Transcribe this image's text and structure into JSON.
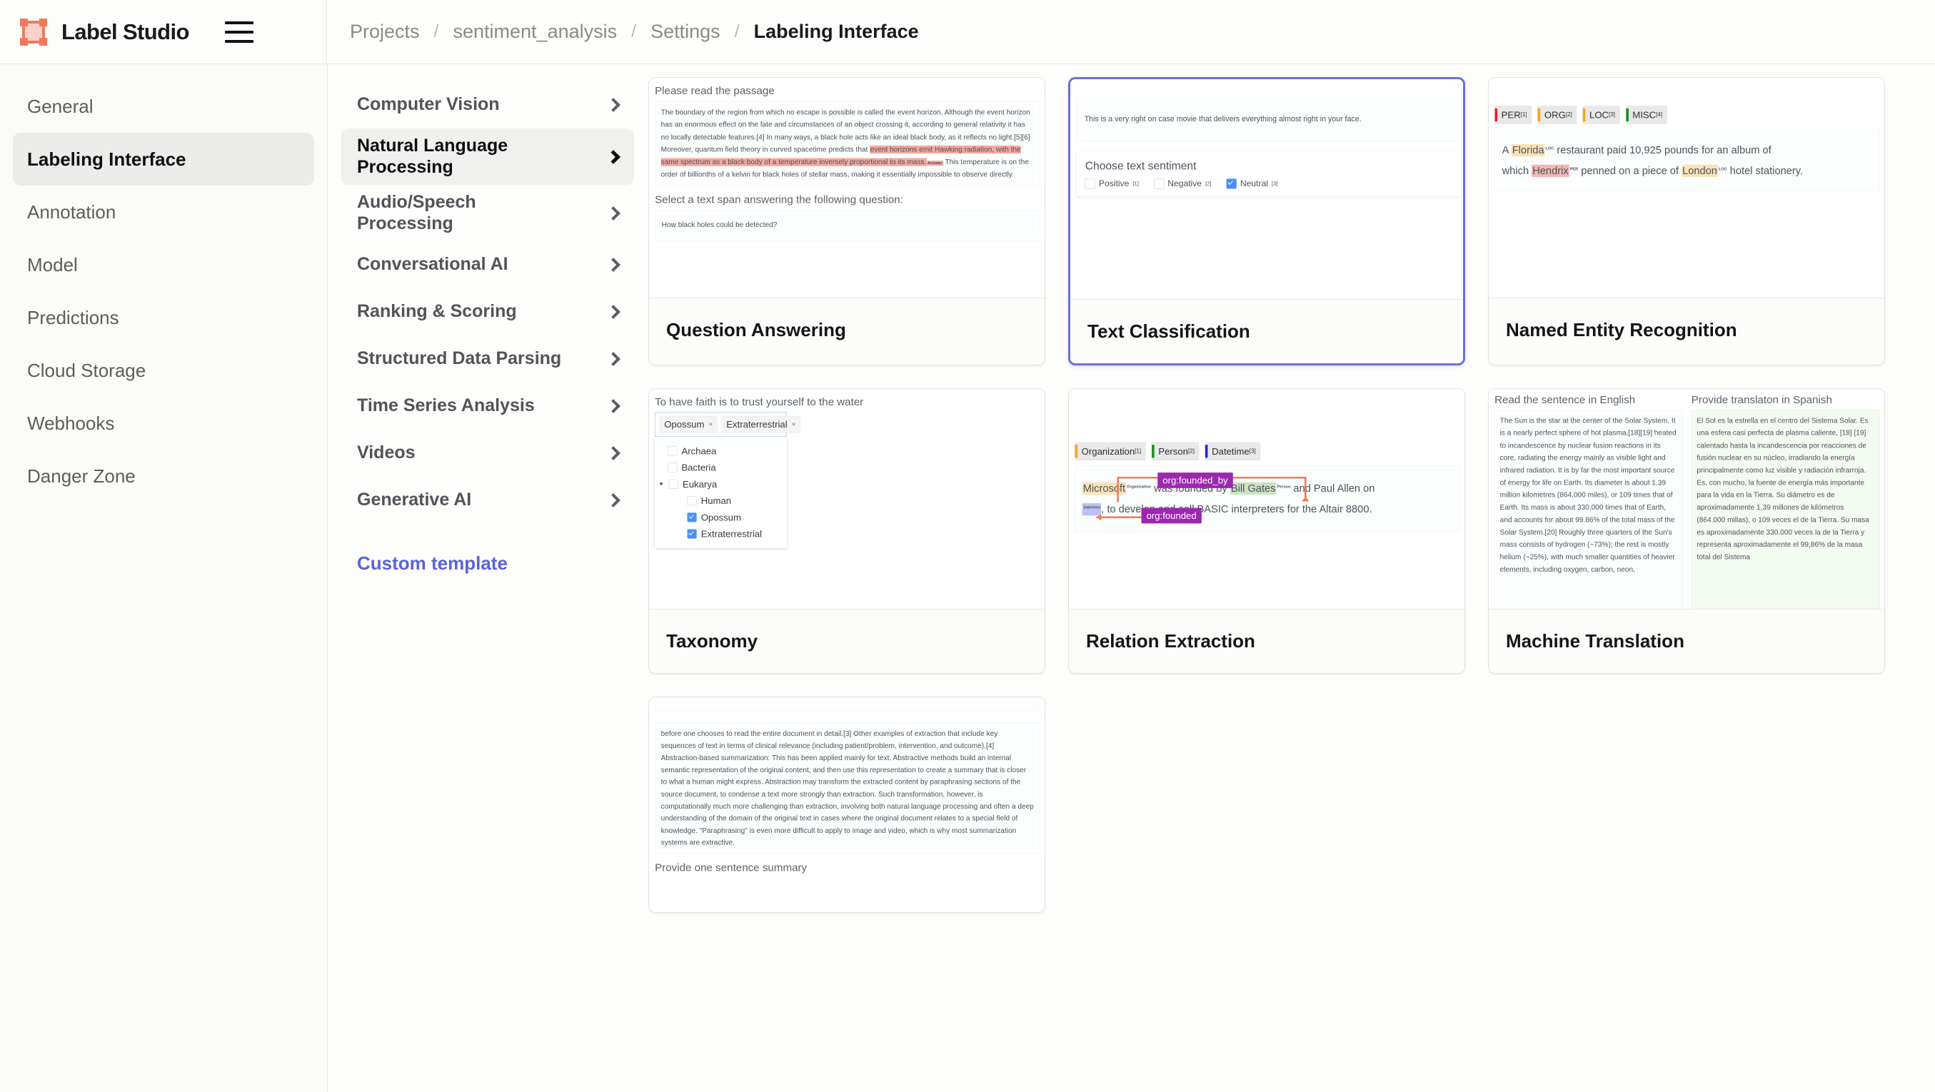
{
  "app": {
    "brand": "Label Studio",
    "logo_icon": "bounding-box-logo-icon",
    "menu_icon": "hamburger-menu-icon"
  },
  "breadcrumb": {
    "items": [
      "Projects",
      "sentiment_analysis",
      "Settings",
      "Labeling Interface"
    ],
    "separator": "/"
  },
  "settings_nav": {
    "items": [
      {
        "label": "General",
        "active": false
      },
      {
        "label": "Labeling Interface",
        "active": true
      },
      {
        "label": "Annotation",
        "active": false
      },
      {
        "label": "Model",
        "active": false
      },
      {
        "label": "Predictions",
        "active": false
      },
      {
        "label": "Cloud Storage",
        "active": false
      },
      {
        "label": "Webhooks",
        "active": false
      },
      {
        "label": "Danger Zone",
        "active": false
      }
    ]
  },
  "categories": {
    "items": [
      {
        "label": "Computer Vision",
        "active": false
      },
      {
        "label": "Natural Language Processing",
        "active": true
      },
      {
        "label": "Audio/Speech Processing",
        "active": false
      },
      {
        "label": "Conversational AI",
        "active": false
      },
      {
        "label": "Ranking & Scoring",
        "active": false
      },
      {
        "label": "Structured Data Parsing",
        "active": false
      },
      {
        "label": "Time Series Analysis",
        "active": false
      },
      {
        "label": "Videos",
        "active": false
      },
      {
        "label": "Generative AI",
        "active": false
      }
    ],
    "custom_template_link": "Custom template"
  },
  "templates": {
    "question_answering": {
      "title": "Question Answering",
      "passage_label": "Please read the passage",
      "passage_pre": "The boundary of the region from which no escape is possible is called the event horizon. Although the event horizon has an enormous effect on the fate and circumstances of an object crossing it, according to general relativity it has no locally detectable features.[4] In many ways, a black hole acts like an ideal black body, as it reflects no light.[5][6] Moreover, quantum field theory in curved spacetime predicts that ",
      "passage_highlight": "event horizons emit Hawking radiation, with the same spectrum as a black body of a temperature inversely proportional to its mass.",
      "passage_highlight_tag": "Answer",
      "passage_post": " This temperature is on the order of billionths of a kelvin for black holes of stellar mass, making it essentially impossible to observe directly.",
      "question_label": "Select a text span answering the following question:",
      "question_text": "How black holes could be detected?"
    },
    "text_classification": {
      "title": "Text Classification",
      "selected": true,
      "text": "This is a very right on case movie that delivers everything almost right in your face.",
      "choices_title": "Choose text sentiment",
      "choices": [
        {
          "label": "Positive",
          "hotkey": "[1]",
          "checked": false
        },
        {
          "label": "Negative",
          "hotkey": "[2]",
          "checked": false
        },
        {
          "label": "Neutral",
          "hotkey": "[3]",
          "checked": true
        }
      ]
    },
    "named_entity_recognition": {
      "title": "Named Entity Recognition",
      "labels": [
        {
          "name": "PER",
          "hotkey": "[1]",
          "color": "#ed1c24"
        },
        {
          "name": "ORG",
          "hotkey": "[2]",
          "color": "#f5a623"
        },
        {
          "name": "LOC",
          "hotkey": "[3]",
          "color": "#f5a623"
        },
        {
          "name": "MISC",
          "hotkey": "[4]",
          "color": "#1d8a1d"
        }
      ],
      "text_a": "A ",
      "ent_florida": "Florida",
      "ent_florida_tag": "LOC",
      "text_b": " restaurant paid 10,925 pounds for an album of ",
      "text_c": "which ",
      "ent_hendrix": "Hendrix",
      "ent_hendrix_tag": "PER",
      "text_d": " penned on a piece of ",
      "ent_london": "London",
      "ent_london_tag": "LOC",
      "text_e": " hotel stationery."
    },
    "taxonomy": {
      "title": "Taxonomy",
      "prompt": "To have faith is to trust yourself to the water",
      "selected_tags": [
        "Opossum",
        "Extraterrestrial"
      ],
      "remove_icon": "×",
      "options": [
        {
          "label": "Archaea",
          "checked": false,
          "indent": false,
          "expandable": false
        },
        {
          "label": "Bacteria",
          "checked": false,
          "indent": false,
          "expandable": false
        },
        {
          "label": "Eukarya",
          "checked": false,
          "indent": false,
          "expandable": true
        },
        {
          "label": "Human",
          "checked": false,
          "indent": true,
          "expandable": false
        },
        {
          "label": "Opossum",
          "checked": true,
          "indent": true,
          "expandable": false
        },
        {
          "label": "Extraterrestrial",
          "checked": true,
          "indent": true,
          "expandable": false
        }
      ]
    },
    "relation_extraction": {
      "title": "Relation Extraction",
      "labels": [
        {
          "name": "Organization",
          "hotkey": "[1]",
          "color": "#f5a623"
        },
        {
          "name": "Person",
          "hotkey": "[2]",
          "color": "#1d8a1d"
        },
        {
          "name": "Datetime",
          "hotkey": "[3]",
          "color": "#2222ee"
        }
      ],
      "relation_top": "org:founded_by",
      "relation_bottom": "org:founded",
      "ent_microsoft": "Microsoft",
      "ent_microsoft_tag": "Organization",
      "text_a": " was founded by ",
      "ent_bill_gates": "Bill Gates",
      "ent_bill_gates_tag": "Person",
      "text_b": " and Paul Allen on ",
      "ent_date_tag": "Datetime",
      "text_c": ", to develop and sell BASIC interpreters for the Altair 8800."
    },
    "machine_translation": {
      "title": "Machine Translation",
      "source_label": "Read the sentence in English",
      "target_label": "Provide translaton in Spanish",
      "source_text": "The Sun is the star at the center of the Solar System. It is a nearly perfect sphere of hot plasma,[18][19] heated to incandescence by nuclear fusion reactions in its core, radiating the energy mainly as visible light and infrared radiation. It is by far the most important source of energy for life on Earth. Its diameter is about 1.39 million kilometres (864,000 miles), or 109 times that of Earth. Its mass is about 330,000 times that of Earth, and accounts for about 99.86% of the total mass of the Solar System.[20] Roughly three quarters of the Sun's mass consists of hydrogen (~73%); the rest is mostly helium (~25%), with much smaller quantities of heavier elements, including oxygen, carbon, neon,",
      "target_text": "El Sol es la estrella en el centro del Sistema Solar. Es una esfera casi perfecta de plasma caliente, [18] [19] calentado hasta la incandescencia por reacciones de fusión nuclear en su núcleo, irradiando la energía principalmente como luz visible y radiación infrarroja. Es, con mucho, la fuente de energía más importante para la vida en la Tierra. Su diámetro es de aproximadamente 1,39 millones de kilómetros (864.000 millas), o 109 veces el de la Tierra. Su masa es aproximadamente 330.000 veces la de la Tierra y representa aproximadamente el 99,86% de la masa total del Sistema"
    },
    "summarization": {
      "text": "before one chooses to read the entire document in detail.[3] Other examples of extraction that include key sequences of text in terms of clinical relevance (including patient/problem, intervention, and outcome).[4] Abstraction-based summarization: This has been applied mainly for text. Abstractive methods build an internal semantic representation of the original content, and then use this representation to create a summary that is closer to what a human might express. Abstraction may transform the extracted content by paraphrasing sections of the source document, to condense a text more strongly than extraction. Such transformation, however, is computationally much more challenging than extraction, involving both natural language processing and often a deep understanding of the domain of the original text in cases where the original document relates to a special field of knowledge. \"Paraphrasing\" is even more difficult to apply to image and video, which is why most summarization systems are extractive.",
      "summary_label": "Provide one sentence summary"
    }
  },
  "colors": {
    "accent": "#5a63d8",
    "logo": "#f0795f",
    "selected_border": "#6673d8",
    "checkbox_on": "#4a90f7",
    "relation_tag": "#9c27b0",
    "answer_highlight": "#f4a8a0"
  }
}
